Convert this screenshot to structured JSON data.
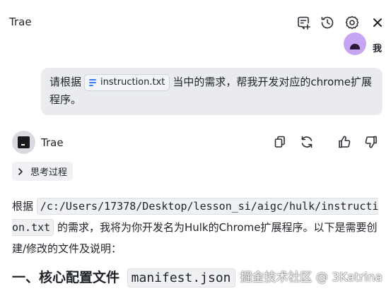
{
  "header": {
    "title": "Trae",
    "icons": [
      "new-chat-icon",
      "history-icon",
      "settings-icon",
      "close-icon"
    ]
  },
  "previous_message": {
    "name_fragment": "我"
  },
  "user_message": {
    "text_before": "请根据",
    "file_chip": "instruction.txt",
    "text_after": "当中的需求，帮我开发对应的chrome扩展程序。"
  },
  "assistant": {
    "name": "Trae",
    "actions": [
      "copy-icon",
      "regenerate-icon",
      "thumbs-up-icon",
      "thumbs-down-icon"
    ],
    "thinking_label": "思考过程",
    "response": {
      "prefix": "根据",
      "code_path": "/c:/Users/17378/Desktop/lesson_si/aigc/hulk/instruction.txt",
      "suffix": "的需求，我将为你开发名为Hulk的Chrome扩展程序。以下是需要创建/修改的文件及说明："
    },
    "section_heading": {
      "text": "一、核心配置文件",
      "code": "manifest.json"
    }
  },
  "watermark": "掘金技术社区 @ 3Katrina"
}
